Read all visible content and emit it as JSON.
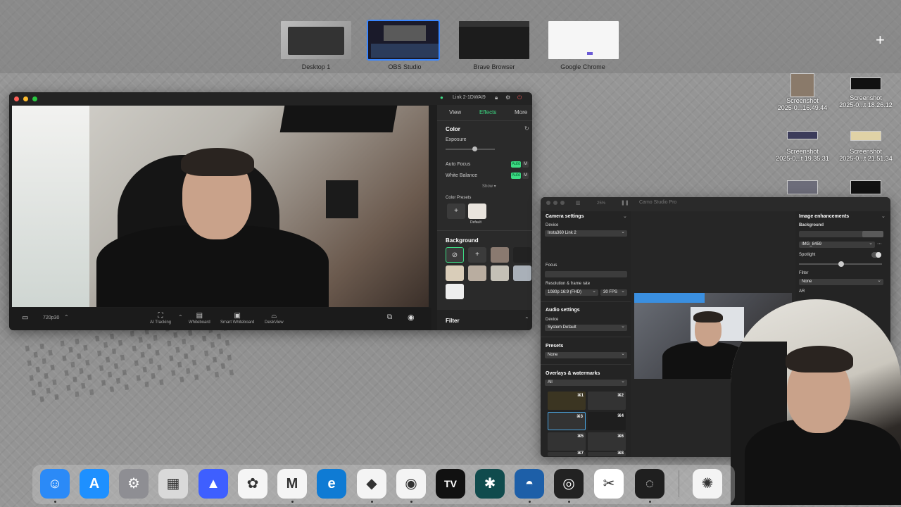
{
  "spaces": [
    {
      "label": "Desktop 1",
      "active": false
    },
    {
      "label": "OBS Studio",
      "active": true
    },
    {
      "label": "Brave Browser",
      "active": false
    },
    {
      "label": "Google Chrome",
      "active": false
    }
  ],
  "add_space_symbol": "+",
  "desktop_files": [
    {
      "name_line1": "Screenshot",
      "name_line2": "2025-0...16.49.44"
    },
    {
      "name_line1": "Screenshot",
      "name_line2": "2025-0...t 18.26.12"
    },
    {
      "name_line1": "Screenshot",
      "name_line2": "2025-0...t 19.35.31"
    },
    {
      "name_line1": "Screenshot",
      "name_line2": "2025-0...t 21.51.34"
    }
  ],
  "cam_window": {
    "device_name": "Link 2-1DWAI9",
    "resolution_label": "720p30",
    "tabs": [
      "View",
      "Effects",
      "More"
    ],
    "active_tab": "Effects",
    "color_header": "Color",
    "exposure_label": "Exposure",
    "auto_focus_label": "Auto Focus",
    "white_balance_label": "White Balance",
    "auto_label": "Auto",
    "manual_label": "M",
    "show_label": "Show ▾",
    "color_presets_label": "Color Presets",
    "preset_default": "Default",
    "background_header": "Background",
    "filter_header": "Filter",
    "tools": [
      "AI Tracking",
      "Whiteboard",
      "Smart Whiteboard",
      "DeskView"
    ]
  },
  "studio": {
    "title": "Camo Studio Pro",
    "zoom": "25%",
    "camera_settings": "Camera settings",
    "device_label": "Device",
    "device_value": "Insta360 Link 2",
    "focus_label": "Focus",
    "resolution_label": "Resolution & frame rate",
    "resolution_value": "1080p 16:9 (FHD)",
    "fps_value": "30 FPS",
    "audio_settings": "Audio settings",
    "audio_device_label": "Device",
    "audio_device_value": "System Default",
    "presets_label": "Presets",
    "presets_value": "None",
    "overlays_label": "Overlays & watermarks",
    "overlays_filter": "All",
    "overlay_slots": [
      "⌘1",
      "⌘2",
      "⌘3",
      "⌘4",
      "⌘5",
      "⌘6",
      "⌘7",
      "⌘8"
    ],
    "image_enh": "Image enhancements",
    "background_label": "Background",
    "background_value": "IMG_8459",
    "spotlight_label": "Spotlight",
    "filter_label": "Filter",
    "filter_value": "None",
    "ar_label": "AR"
  },
  "dock": [
    {
      "name": "finder-icon",
      "color": "#2b8af7",
      "glyph": "☺"
    },
    {
      "name": "app-store-icon",
      "color": "#1e90ff",
      "glyph": "A"
    },
    {
      "name": "system-settings-icon",
      "color": "#8e8e93",
      "glyph": "⚙"
    },
    {
      "name": "launchpad-icon",
      "color": "#d9d9d9",
      "glyph": "▦"
    },
    {
      "name": "nordvpn-icon",
      "color": "#3e5fff",
      "glyph": "▲"
    },
    {
      "name": "photos-icon",
      "color": "#f5f5f5",
      "glyph": "✿"
    },
    {
      "name": "gmail-icon",
      "color": "#f5f5f5",
      "glyph": "M"
    },
    {
      "name": "edge-icon",
      "color": "#0f7bd4",
      "glyph": "e"
    },
    {
      "name": "brave-icon",
      "color": "#f4f4f4",
      "glyph": "◆"
    },
    {
      "name": "chrome-icon",
      "color": "#f4f4f4",
      "glyph": "◉"
    },
    {
      "name": "tradingview-icon",
      "color": "#111111",
      "glyph": "TV"
    },
    {
      "name": "perplexity-icon",
      "color": "#104b4d",
      "glyph": "✱"
    },
    {
      "name": "camo-icon",
      "color": "#1d5fa8",
      "glyph": "◓"
    },
    {
      "name": "obs-icon",
      "color": "#222222",
      "glyph": "◎"
    },
    {
      "name": "capcut-icon",
      "color": "#ffffff",
      "glyph": "✂"
    },
    {
      "name": "chatgpt-icon",
      "color": "#1f1f1f",
      "glyph": "◌"
    },
    {
      "name": "openai-icon",
      "color": "#f4f4f4",
      "glyph": "✺"
    }
  ]
}
